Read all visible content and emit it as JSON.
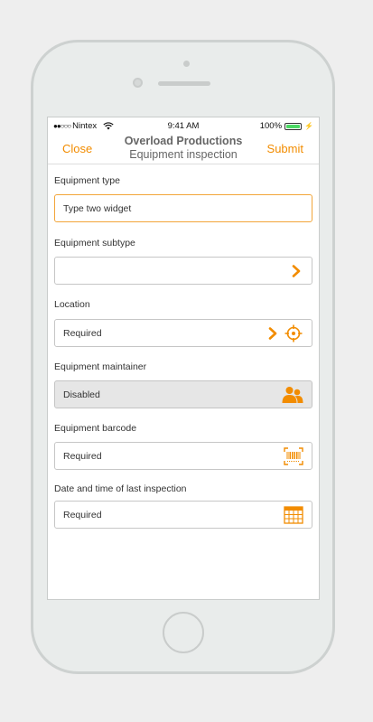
{
  "status_bar": {
    "carrier": "Nintex",
    "signal": "●●○○○",
    "time": "9:41 AM",
    "battery": "100%"
  },
  "nav": {
    "close_label": "Close",
    "title": "Overload Productions",
    "subtitle": "Equipment inspection",
    "submit_label": "Submit"
  },
  "form": {
    "equipment_type": {
      "label": "Equipment type",
      "value": "Type two widget"
    },
    "equipment_subtype": {
      "label": "Equipment subtype",
      "value": ""
    },
    "location": {
      "label": "Location",
      "placeholder": "Required"
    },
    "equipment_maintainer": {
      "label": "Equipment maintainer",
      "value": "Disabled"
    },
    "equipment_barcode": {
      "label": "Equipment barcode",
      "placeholder": "Required"
    },
    "last_inspection": {
      "label": "Date and time of last inspection",
      "placeholder": "Required"
    }
  },
  "icons": {
    "chevron": "chevron-right-icon",
    "locate": "crosshair-icon",
    "people": "people-icon",
    "barcode": "barcode-icon",
    "calendar": "calendar-icon"
  },
  "colors": {
    "accent": "#f28c00",
    "focus_border": "#f2a53a",
    "disabled_bg": "#e6e6e6",
    "battery": "#4cd964"
  }
}
